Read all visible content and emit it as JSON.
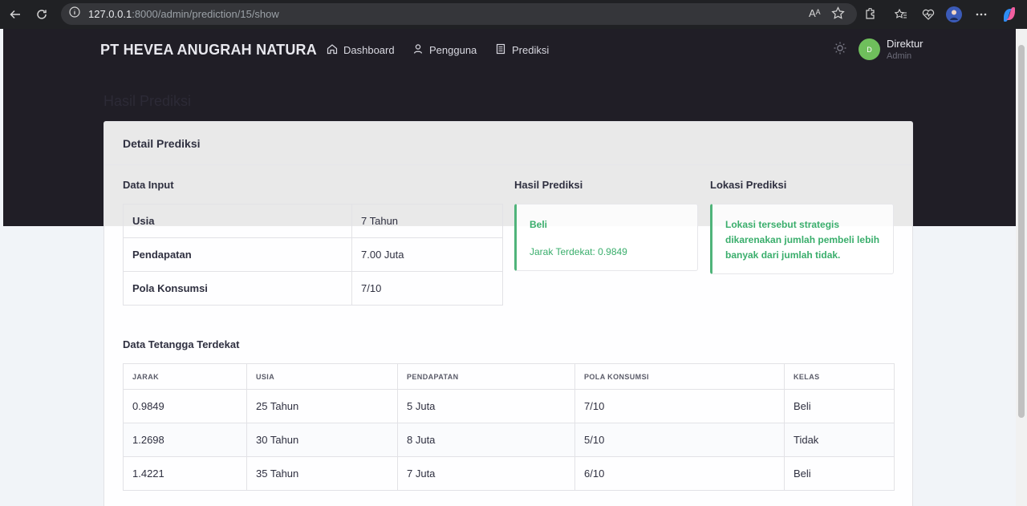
{
  "browser": {
    "url_host": "127.0.0.1",
    "url_rest": ":8000/admin/prediction/15/show",
    "read_aloud": "Aᴬ"
  },
  "header": {
    "brand": "PT HEVEA ANUGRAH NATURA",
    "nav": [
      {
        "label": "Dashboard",
        "icon": "home-icon"
      },
      {
        "label": "Pengguna",
        "icon": "user-icon"
      },
      {
        "label": "Prediksi",
        "icon": "document-icon"
      }
    ],
    "user": {
      "initial": "D",
      "name": "Direktur",
      "role": "Admin"
    }
  },
  "page_title": "Hasil Prediksi",
  "card": {
    "title": "Detail Prediksi",
    "input_section": "Data Input",
    "inputs": [
      {
        "label": "Usia",
        "value": "7 Tahun"
      },
      {
        "label": "Pendapatan",
        "value": "7.00 Juta"
      },
      {
        "label": "Pola Konsumsi",
        "value": "7/10"
      }
    ],
    "result_section": "Hasil Prediksi",
    "result": {
      "label": "Beli",
      "distance": "Jarak Terdekat: 0.9849"
    },
    "location_section": "Lokasi Prediksi",
    "location_text": "Lokasi tersebut strategis dikarenakan jumlah pembeli lebih banyak dari jumlah tidak.",
    "neighbors_section": "Data Tetangga Terdekat",
    "neighbors_columns": [
      "JARAK",
      "USIA",
      "PENDAPATAN",
      "POLA KONSUMSI",
      "KELAS"
    ],
    "neighbors": [
      [
        "0.9849",
        "25 Tahun",
        "5 Juta",
        "7/10",
        "Beli"
      ],
      [
        "1.2698",
        "30 Tahun",
        "8 Juta",
        "5/10",
        "Tidak"
      ],
      [
        "1.4221",
        "35 Tahun",
        "7 Juta",
        "6/10",
        "Beli"
      ]
    ]
  },
  "colors": {
    "accent": "#4fb47a",
    "dark_header": "#201e26",
    "avatar": "#6fbf5c"
  }
}
